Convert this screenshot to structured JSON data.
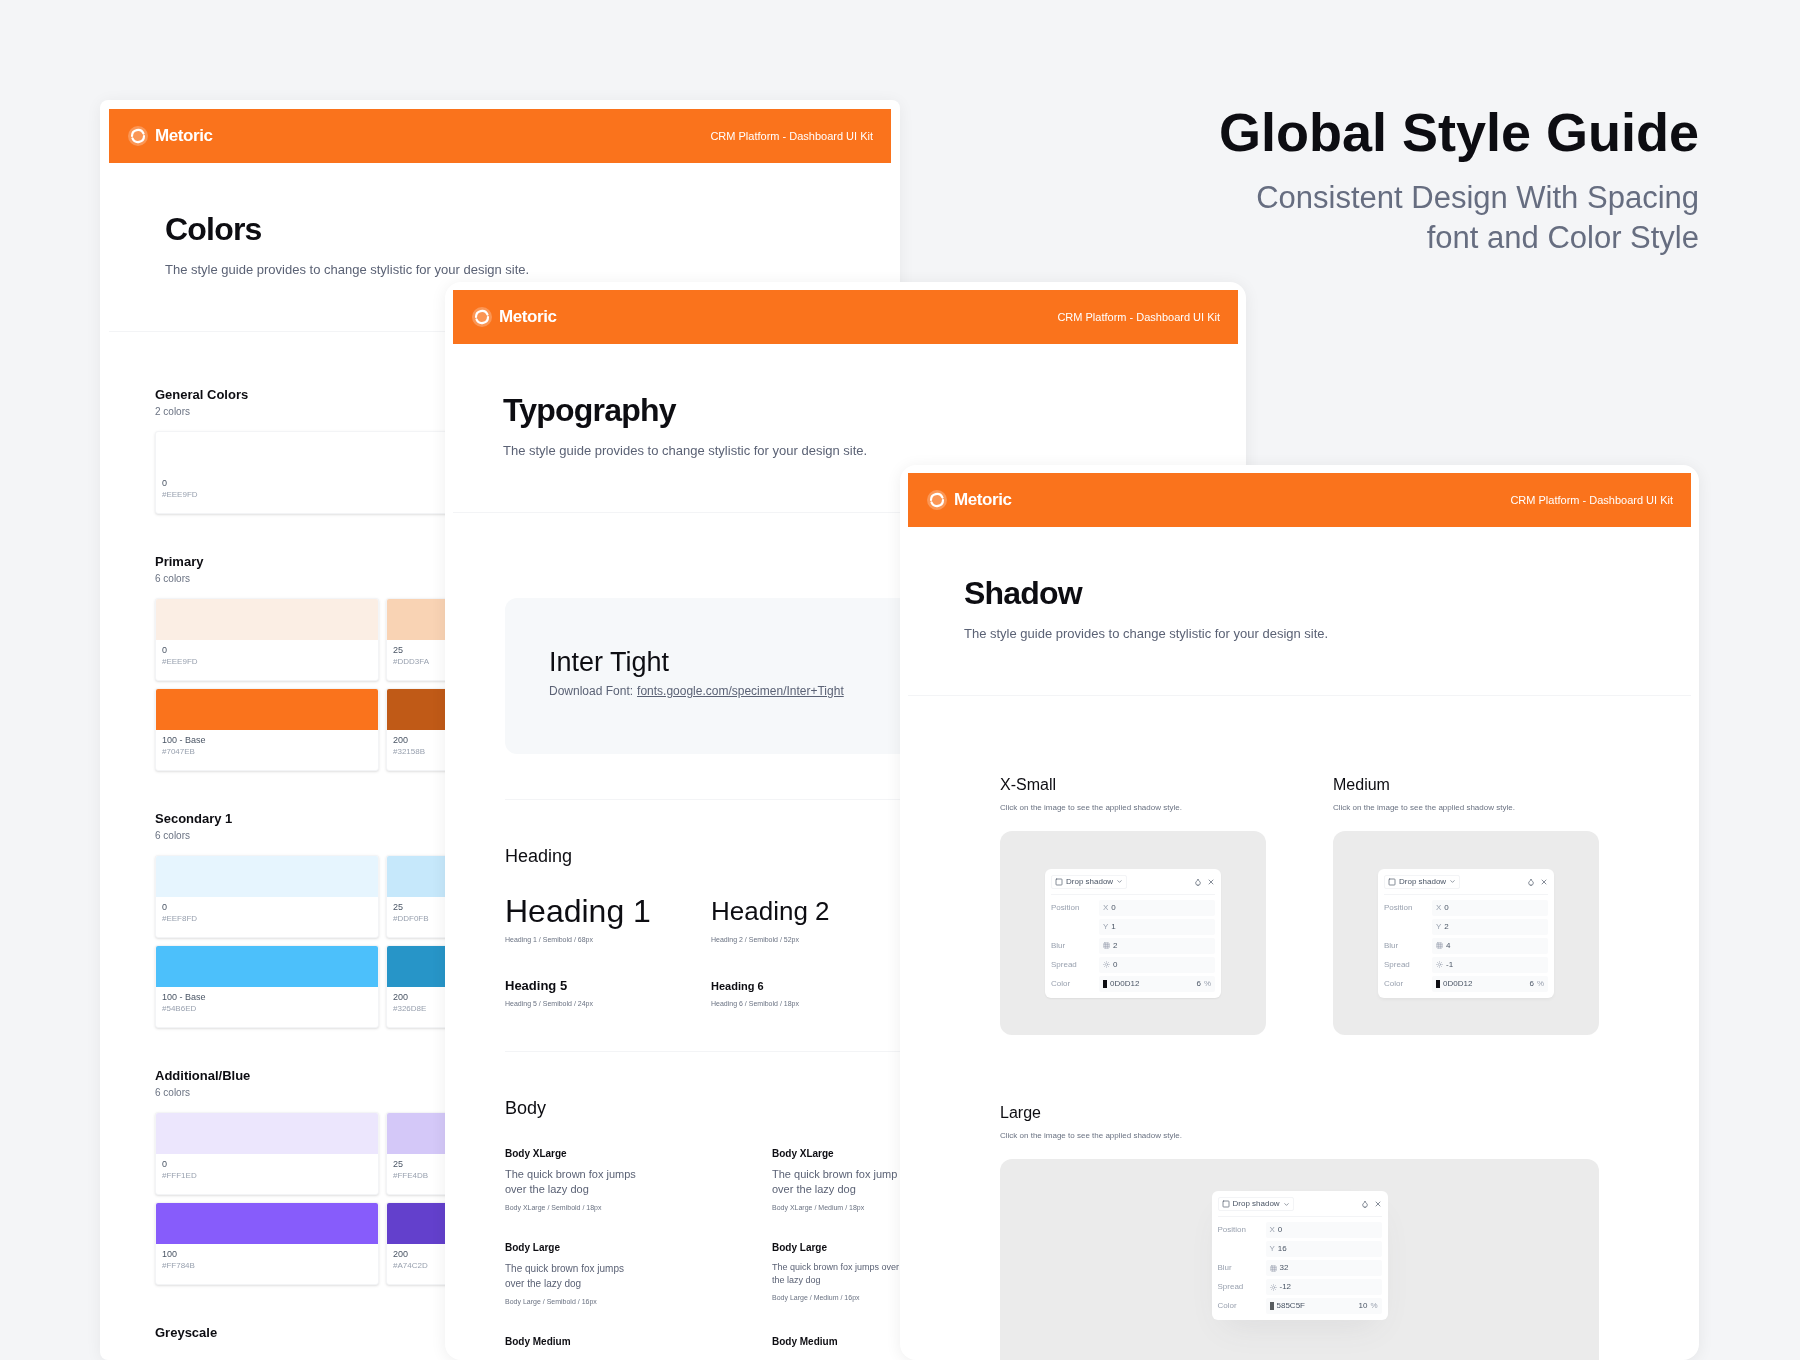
{
  "hero": {
    "title": "Global Style Guide",
    "subtitle": "Consistent Design With Spacing\nfont and Color Style"
  },
  "colors_page": {
    "header": {
      "brand": "Metoric",
      "subtitle": "CRM Platform - Dashboard UI Kit"
    },
    "title": "Colors",
    "description": "The style guide provides to change stylistic for your design site.",
    "groups": [
      {
        "title": "General Colors",
        "count": "2 colors",
        "swatches": [
          {
            "name": "0",
            "hex": "#EEE9FD"
          }
        ]
      },
      {
        "title": "Primary",
        "count": "6 colors",
        "swatches": [
          {
            "name": "0",
            "hex": "#EEE9FD",
            "color": "#fbeee4"
          },
          {
            "name": "25",
            "hex": "#DDD3FA",
            "color": "#f9d3b4"
          },
          {
            "name": "100 - Base",
            "hex": "#7047EB",
            "color": "#fa731c"
          },
          {
            "name": "200",
            "hex": "#32158B",
            "color": "#c05a17"
          }
        ]
      },
      {
        "title": "Secondary 1",
        "count": "6 colors",
        "swatches": [
          {
            "name": "0",
            "hex": "#EEF8FD",
            "color": "#e6f5fe"
          },
          {
            "name": "25",
            "hex": "#DDF0FB",
            "color": "#c6e8fb"
          },
          {
            "name": "100 - Base",
            "hex": "#54B6ED",
            "color": "#4cc0fb"
          },
          {
            "name": "200",
            "hex": "#326D8E",
            "color": "#2795c8"
          }
        ]
      },
      {
        "title": "Additional/Blue",
        "count": "6 colors",
        "swatches": [
          {
            "name": "0",
            "hex": "#FFF1ED",
            "color": "#ece6fd"
          },
          {
            "name": "25",
            "hex": "#FFE4DB",
            "color": "#d4c8f8"
          },
          {
            "name": "100",
            "hex": "#FF784B",
            "color": "#875cfb"
          },
          {
            "name": "200",
            "hex": "#A74C2D",
            "color": "#6340cc"
          }
        ]
      },
      {
        "title": "Greyscale"
      }
    ]
  },
  "typography_page": {
    "header": {
      "brand": "Metoric",
      "subtitle": "CRM Platform - Dashboard UI Kit"
    },
    "title": "Typography",
    "description": "The style guide provides to change stylistic for your design site.",
    "font": {
      "name": "Inter Tight",
      "download_label": "Download Font:",
      "link": "fonts.google.com/specimen/Inter+Tight"
    },
    "heading": {
      "title": "Heading",
      "samples": [
        {
          "kind": "h1",
          "text": "Heading 1",
          "caption": "Heading 1 / Semibold / 68px"
        },
        {
          "kind": "h2",
          "text": "Heading 2",
          "caption": "Heading 2 / Semibold / 52px"
        },
        {
          "kind": "h5",
          "text": "Heading 5",
          "caption": "Heading 5 / Semibold / 24px"
        },
        {
          "kind": "h6",
          "text": "Heading 6",
          "caption": "Heading 6 / Semibold / 18px"
        }
      ]
    },
    "body": {
      "title": "Body",
      "samples": [
        {
          "kind": "xlarge-semibold",
          "name": "Body XLarge",
          "text": "The quick brown fox jumps\nover the lazy dog",
          "caption": "Body XLarge / Semibold / 18px"
        },
        {
          "kind": "xlarge-medium",
          "name": "Body XLarge",
          "text": "The quick brown fox jump\nover the lazy dog",
          "caption": "Body XLarge / Medium / 18px"
        },
        {
          "kind": "large-semibold",
          "name": "Body Large",
          "text": "The quick brown fox jumps\nover the lazy dog",
          "caption": "Body Large / Semibold / 16px"
        },
        {
          "kind": "large-medium",
          "name": "Body Large",
          "text": "The quick brown fox jumps over\nthe lazy dog",
          "caption": "Body Large / Medium / 16px"
        },
        {
          "name": "Body Medium"
        },
        {
          "name": "Body Medium"
        }
      ]
    }
  },
  "shadow_page": {
    "header": {
      "brand": "Metoric",
      "subtitle": "CRM Platform - Dashboard UI Kit"
    },
    "title": "Shadow",
    "description": "The style guide provides to change stylistic for your design site.",
    "styles": [
      {
        "title": "X-Small",
        "hint": "Click on the image to see the applied shadow style.",
        "panel": {
          "label": "Drop shadow",
          "rows": [
            {
              "kind": "position",
              "label": "Position",
              "prefix": "X",
              "value": "0"
            },
            {
              "kind": "position",
              "prefix": "Y",
              "value": "1"
            },
            {
              "kind": "blur",
              "label": "Blur",
              "value": "2"
            },
            {
              "kind": "spread",
              "label": "Spread",
              "value": "0"
            },
            {
              "kind": "color",
              "label": "Color",
              "value": "0D0D12",
              "opacity": "6",
              "unit": "%"
            }
          ]
        }
      },
      {
        "title": "Medium",
        "hint": "Click on the image to see the applied shadow style.",
        "panel": {
          "label": "Drop shadow",
          "rows": [
            {
              "kind": "position",
              "label": "Position",
              "prefix": "X",
              "value": "0"
            },
            {
              "kind": "position",
              "prefix": "Y",
              "value": "2"
            },
            {
              "kind": "blur",
              "label": "Blur",
              "value": "4"
            },
            {
              "kind": "spread",
              "label": "Spread",
              "value": "-1"
            },
            {
              "kind": "color",
              "label": "Color",
              "value": "0D0D12",
              "opacity": "6",
              "unit": "%"
            }
          ]
        }
      },
      {
        "title": "Large",
        "hint": "Click on the image to see the applied shadow style.",
        "panel": {
          "label": "Drop shadow",
          "rows": [
            {
              "kind": "position",
              "label": "Position",
              "prefix": "X",
              "value": "0"
            },
            {
              "kind": "position",
              "prefix": "Y",
              "value": "16"
            },
            {
              "kind": "blur",
              "label": "Blur",
              "value": "32"
            },
            {
              "kind": "spread",
              "label": "Spread",
              "value": "-12"
            },
            {
              "kind": "color",
              "label": "Color",
              "value": "585C5F",
              "opacity": "10",
              "unit": "%"
            }
          ]
        }
      }
    ]
  }
}
